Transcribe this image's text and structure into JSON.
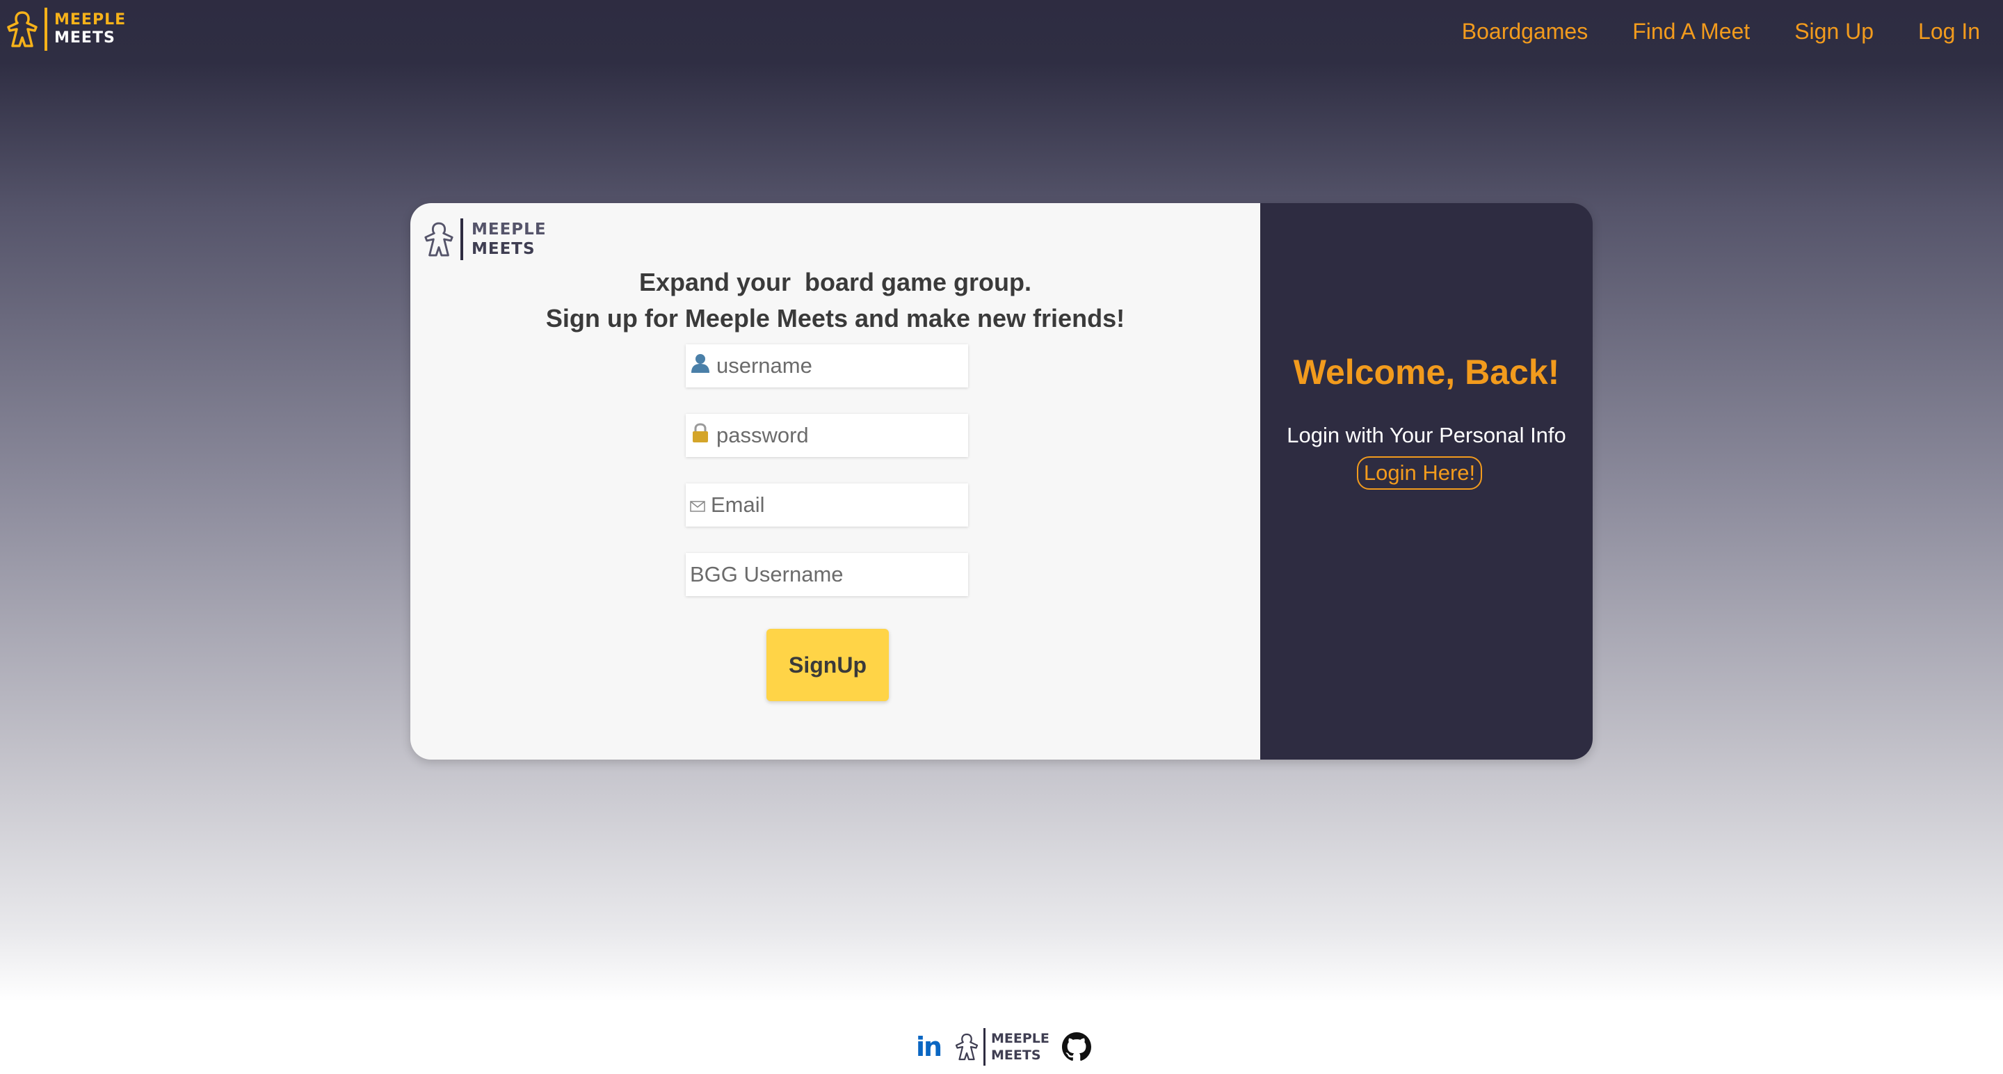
{
  "header": {
    "brand": {
      "line1": "MEEPLE",
      "line2": "MEETS"
    },
    "nav": [
      "Boardgames",
      "Find A Meet",
      "Sign Up",
      "Log In"
    ]
  },
  "signup": {
    "logo": {
      "line1": "MEEPLE",
      "line2": "MEETS"
    },
    "headline_line1": "Expand your  board game group.",
    "headline_line2": "Sign up for Meeple Meets and make new friends!",
    "fields": {
      "username": {
        "icon": "user-icon",
        "placeholder": "username",
        "value": ""
      },
      "password": {
        "icon": "lock-icon",
        "placeholder": "password",
        "value": ""
      },
      "email": {
        "icon": "envelope-icon",
        "placeholder": "Email",
        "value": ""
      },
      "bgg": {
        "placeholder": "BGG Username",
        "value": ""
      }
    },
    "submit_label": "SignUp"
  },
  "login_panel": {
    "title": "Welcome, Back!",
    "subtitle": "Login with Your Personal Info",
    "button_label": "Login Here!"
  },
  "footer": {
    "linkedin_label": "in",
    "logo": {
      "line1": "MEEPLE",
      "line2": "MEETS"
    },
    "icons": [
      "linkedin-icon",
      "meeple-icon",
      "github-icon"
    ]
  },
  "colors": {
    "accent": "#f29b1d",
    "brand_yellow": "#f6b21a",
    "button_yellow": "#ffd447",
    "panel_dark": "#2e2c41"
  }
}
